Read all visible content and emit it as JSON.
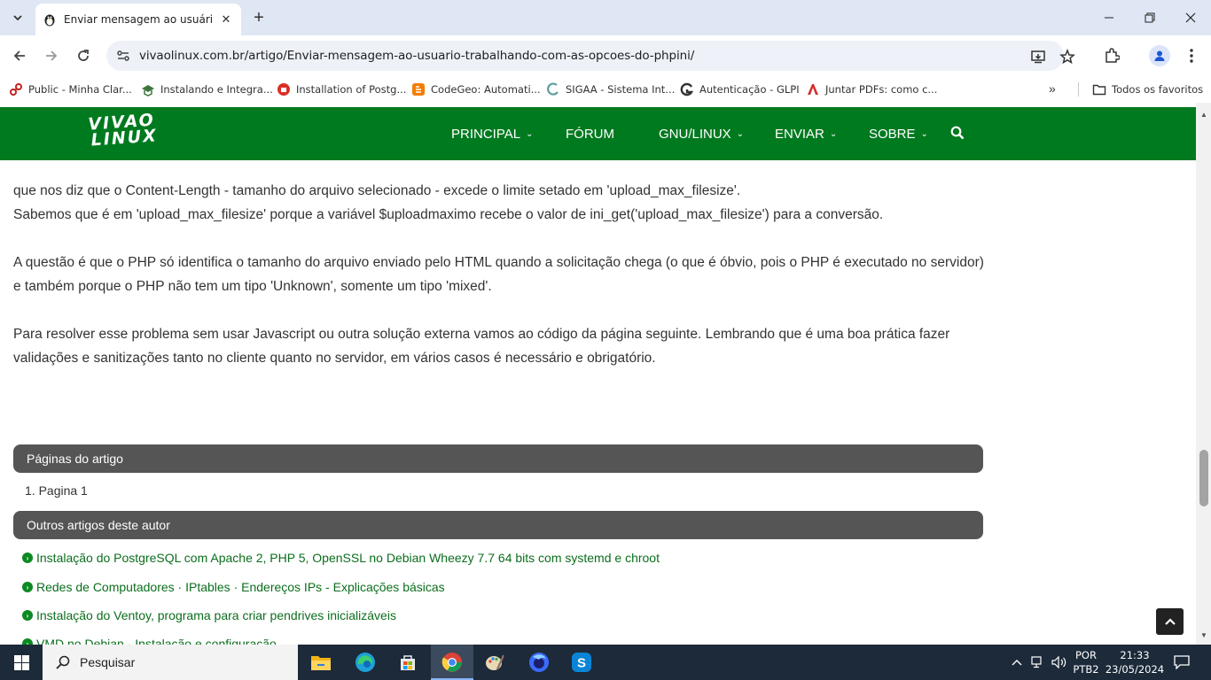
{
  "browser": {
    "tab_title": "Enviar mensagem ao usuário tra",
    "url": "vivaolinux.com.br/artigo/Enviar-mensagem-ao-usuario-trabalhando-com-as-opcoes-do-phpini/",
    "bookmarks": [
      {
        "label": "Public - Minha Clar...",
        "icon": "pin-icon",
        "color": "#c5221f"
      },
      {
        "label": "Instalando e Integra...",
        "icon": "hat-icon",
        "color": "#3c763d"
      },
      {
        "label": "Installation of Postg...",
        "icon": "bug-icon",
        "color": "#d93025"
      },
      {
        "label": "CodeGeo: Automati...",
        "icon": "blogger-icon",
        "color": "#f57c00"
      },
      {
        "label": "SIGAA - Sistema Int...",
        "icon": "sigaa-icon",
        "color": "#5f9ea0"
      },
      {
        "label": "Autenticação - GLPI",
        "icon": "glpi-icon",
        "color": "#333333"
      },
      {
        "label": "Juntar PDFs: como c...",
        "icon": "pdf-icon",
        "color": "#d32f2f"
      }
    ],
    "all_bookmarks": "Todos os favoritos"
  },
  "site": {
    "logo_line1": "VIVAO",
    "logo_line2": "LINUX",
    "menu": [
      {
        "label": "PRINCIPAL",
        "chevron": "⌄"
      },
      {
        "label": "FÓRUM",
        "chevron": ""
      },
      {
        "label": "GNU/LINUX",
        "chevron": "⌄"
      },
      {
        "label": "ENVIAR",
        "chevron": "⌄"
      },
      {
        "label": "SOBRE",
        "chevron": "⌄"
      }
    ],
    "brand_color": "#007a1f"
  },
  "article": {
    "p1_line1": "que nos diz que o Content-Length - tamanho do arquivo selecionado - excede o limite setado em 'upload_max_filesize'.",
    "p1_line2": "Sabemos que é em 'upload_max_filesize' porque a variável $uploadmaximo recebe o valor de ini_get('upload_max_filesize') para a conversão.",
    "p2": "A questão é que o PHP só identifica o tamanho do arquivo enviado pelo HTML quando a solicitação chega (o que é óbvio, pois o PHP é executado no servidor) e também porque o PHP não tem um tipo 'Unknown', somente um tipo 'mixed'.",
    "p3": "Para resolver esse problema sem usar Javascript ou outra solução externa vamos ao código da página seguinte. Lembrando que é uma boa prática fazer validações e sanitizações tanto no cliente quanto no servidor, em vários casos é necessário e obrigatório."
  },
  "pages_panel": {
    "title": "Páginas do artigo",
    "items": [
      "1. Pagina 1"
    ]
  },
  "other_panel": {
    "title": "Outros artigos deste autor",
    "items": [
      "Instalação do PostgreSQL com Apache 2, PHP 5, OpenSSL no Debian Wheezy 7.7 64 bits com systemd e chroot",
      "Redes de Computadores · IPtables · Endereços IPs - Explicações básicas",
      "Instalação do Ventoy, programa para criar pendrives inicializáveis",
      "VMD no Debian - Instalação e configuração"
    ]
  },
  "taskbar": {
    "search_label": "Pesquisar",
    "lang_line1": "POR",
    "lang_line2": "PTB2",
    "time": "21:33",
    "date": "23/05/2024"
  }
}
